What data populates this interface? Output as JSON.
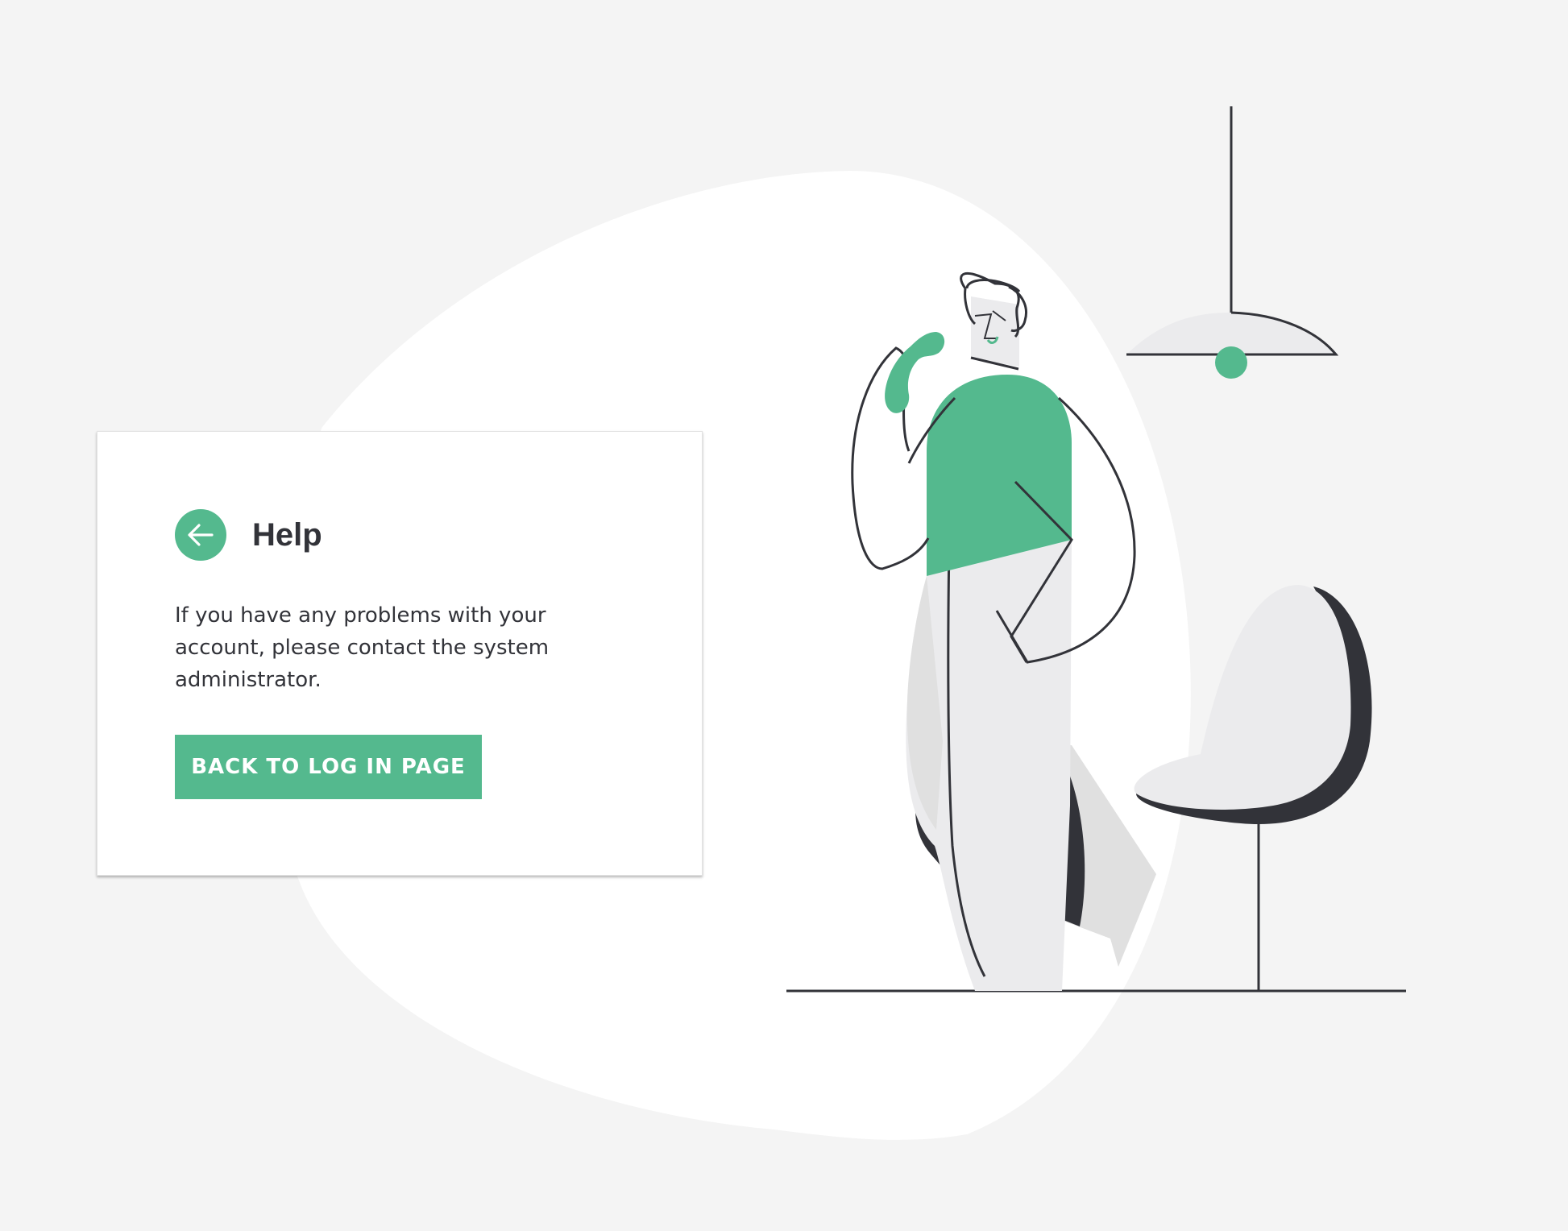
{
  "page": {
    "title": "Help"
  },
  "help_card": {
    "title": "Help",
    "back_icon": "arrow-left-icon",
    "message": "If you have any problems with your account, please contact the system administrator.",
    "back_button_label": "BACK TO LOG IN PAGE"
  },
  "illustration": {
    "subject": "person-on-phone",
    "elements": [
      "background-blob",
      "person",
      "phone",
      "pendant-lamp",
      "egg-chair",
      "floor-line"
    ]
  },
  "colors": {
    "background": "#f4f4f4",
    "card": "#ffffff",
    "accent": "#54b98e",
    "text": "#323339",
    "illustration_gray": "#ebebed",
    "illustration_dark": "#323339"
  }
}
